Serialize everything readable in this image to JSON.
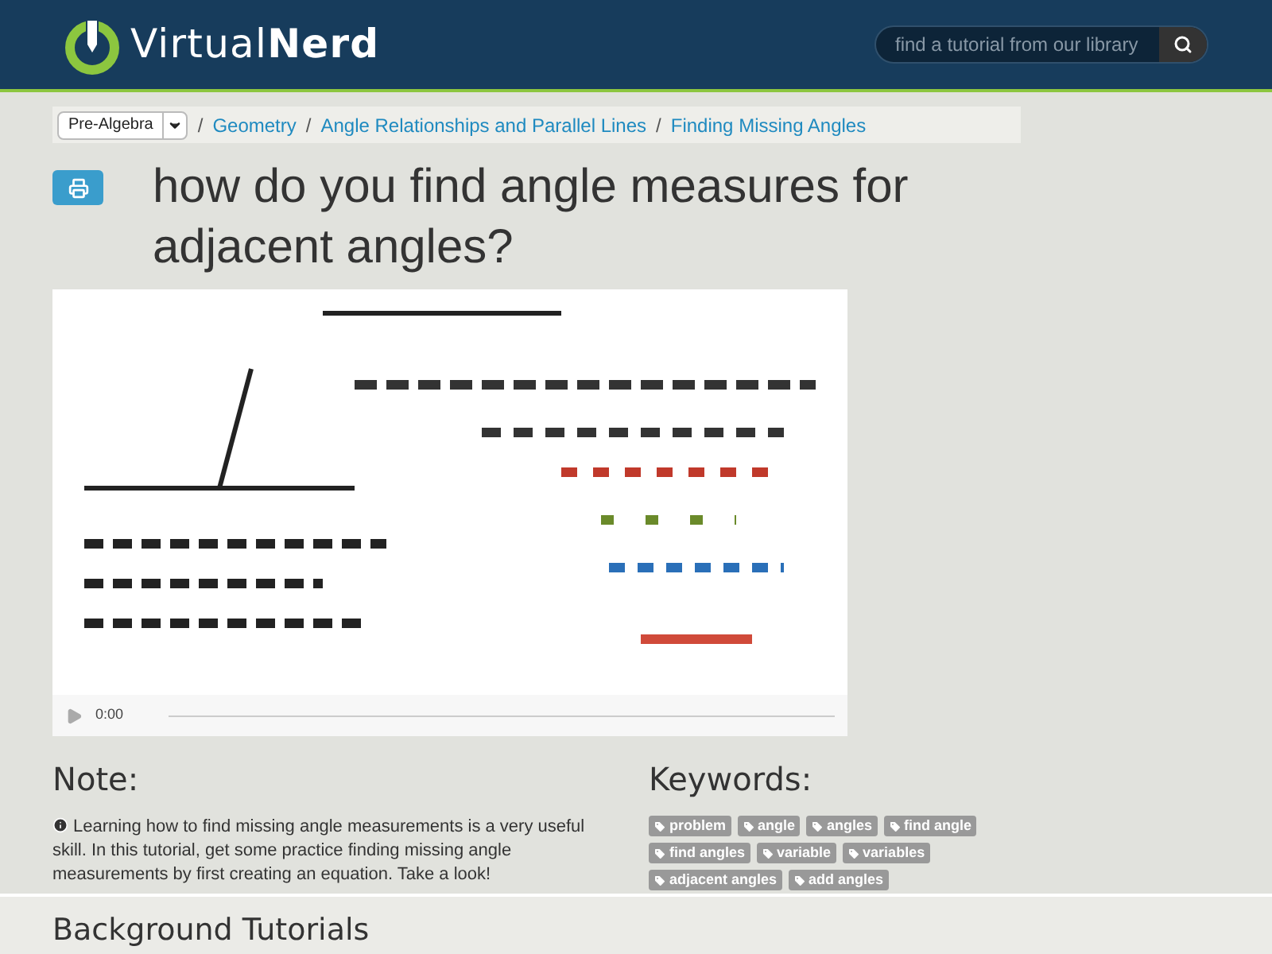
{
  "header": {
    "logo": {
      "part_1": "Virtual",
      "part_2": "Nerd"
    },
    "search": {
      "placeholder": "find a tutorial from our library"
    }
  },
  "breadcrumb": {
    "subject": "Pre-Algebra",
    "links": [
      "Geometry",
      "Angle Relationships and Parallel Lines",
      "Finding Missing Angles"
    ],
    "separator": "/"
  },
  "title": "how do you find angle measures for adjacent angles?",
  "video": {
    "time": "0:00"
  },
  "note": {
    "heading": "Note:",
    "text": "Learning how to find missing angle measurements is a very useful skill. In this tutorial, get some practice finding missing angle measurements by first creating an equation. Take a look!"
  },
  "keywords": {
    "heading": "Keywords:",
    "tags": [
      "problem",
      "angle",
      "angles",
      "find angle",
      "find angles",
      "variable",
      "variables",
      "adjacent angles",
      "add angles"
    ]
  },
  "background_tutorials": {
    "heading": "Background Tutorials"
  }
}
